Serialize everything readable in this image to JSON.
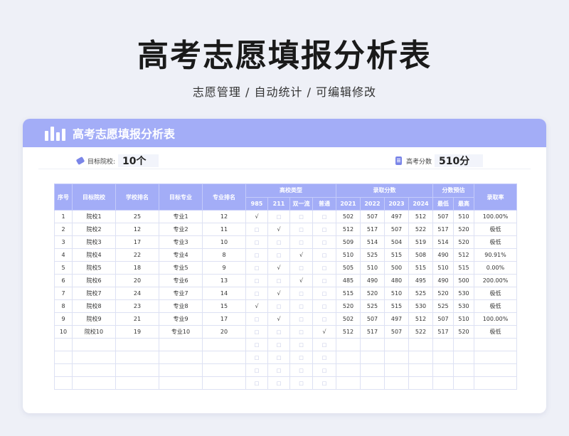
{
  "page": {
    "title": "高考志愿填报分析表",
    "subtitle": "志愿管理 / 自动统计 /  可编辑修改"
  },
  "card": {
    "title": "高考志愿填报分析表",
    "target_label": "目标院校:",
    "target_value": "10个",
    "score_label": "高考分数",
    "score_value": "510分"
  },
  "table": {
    "headers": {
      "seq": "序号",
      "school": "目标院校",
      "school_rank": "学校排名",
      "major": "目标专业",
      "major_rank": "专业排名",
      "type_group": "高校类型",
      "types": [
        "985",
        "211",
        "双一流",
        "普通"
      ],
      "score_group": "录取分数",
      "years": [
        "2021",
        "2022",
        "2023",
        "2024"
      ],
      "estimate_group": "分数预估",
      "estimates": [
        "最低",
        "最高"
      ],
      "rate": "录取率"
    },
    "check_mark": "√",
    "empty_box": "□",
    "rows": [
      {
        "seq": "1",
        "school": "院校1",
        "school_rank": "25",
        "major": "专业1",
        "major_rank": "12",
        "type": 0,
        "scores": [
          "502",
          "507",
          "497",
          "512"
        ],
        "min": "507",
        "max": "510",
        "rate": "100.00%"
      },
      {
        "seq": "2",
        "school": "院校2",
        "school_rank": "12",
        "major": "专业2",
        "major_rank": "11",
        "type": 1,
        "scores": [
          "512",
          "517",
          "507",
          "522"
        ],
        "min": "517",
        "max": "520",
        "rate": "极低"
      },
      {
        "seq": "3",
        "school": "院校3",
        "school_rank": "17",
        "major": "专业3",
        "major_rank": "10",
        "type": -1,
        "scores": [
          "509",
          "514",
          "504",
          "519"
        ],
        "min": "514",
        "max": "520",
        "rate": "极低"
      },
      {
        "seq": "4",
        "school": "院校4",
        "school_rank": "22",
        "major": "专业4",
        "major_rank": "8",
        "type": 2,
        "scores": [
          "510",
          "525",
          "515",
          "508"
        ],
        "min": "490",
        "max": "512",
        "rate": "90.91%"
      },
      {
        "seq": "5",
        "school": "院校5",
        "school_rank": "18",
        "major": "专业5",
        "major_rank": "9",
        "type": 1,
        "scores": [
          "505",
          "510",
          "500",
          "515"
        ],
        "min": "510",
        "max": "515",
        "rate": "0.00%"
      },
      {
        "seq": "6",
        "school": "院校6",
        "school_rank": "20",
        "major": "专业6",
        "major_rank": "13",
        "type": 2,
        "scores": [
          "485",
          "490",
          "480",
          "495"
        ],
        "min": "490",
        "max": "500",
        "rate": "200.00%"
      },
      {
        "seq": "7",
        "school": "院校7",
        "school_rank": "24",
        "major": "专业7",
        "major_rank": "14",
        "type": 1,
        "scores": [
          "515",
          "520",
          "510",
          "525"
        ],
        "min": "520",
        "max": "530",
        "rate": "极低"
      },
      {
        "seq": "8",
        "school": "院校8",
        "school_rank": "23",
        "major": "专业8",
        "major_rank": "15",
        "type": 0,
        "scores": [
          "520",
          "525",
          "515",
          "530"
        ],
        "min": "525",
        "max": "530",
        "rate": "极低"
      },
      {
        "seq": "9",
        "school": "院校9",
        "school_rank": "21",
        "major": "专业9",
        "major_rank": "17",
        "type": 1,
        "scores": [
          "502",
          "507",
          "497",
          "512"
        ],
        "min": "507",
        "max": "510",
        "rate": "100.00%"
      },
      {
        "seq": "10",
        "school": "院校10",
        "school_rank": "19",
        "major": "专业10",
        "major_rank": "20",
        "type": 3,
        "scores": [
          "512",
          "517",
          "507",
          "522"
        ],
        "min": "517",
        "max": "520",
        "rate": "极低"
      }
    ],
    "empty_rows": 4
  },
  "colors": {
    "accent": "#a3adf7",
    "check": "#5566ee",
    "background": "#eef0f7"
  }
}
